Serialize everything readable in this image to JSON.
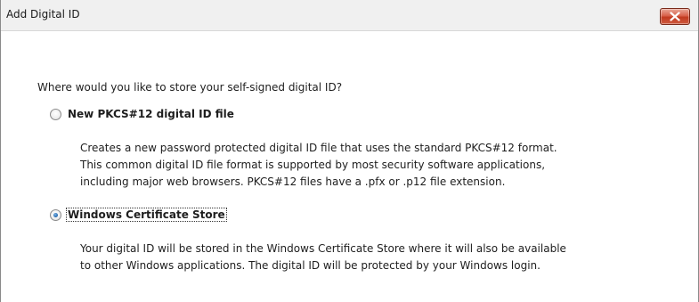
{
  "window": {
    "title": "Add Digital ID",
    "close_icon": "close-icon"
  },
  "content": {
    "question": "Where would you like to store your self-signed digital ID?",
    "options": [
      {
        "label": "New PKCS#12 digital ID file",
        "selected": false,
        "description": [
          "Creates a new password protected digital ID file that uses the standard PKCS#12 format.",
          "This common digital ID file format is supported by most security software applications,",
          "including major web browsers. PKCS#12 files have a .pfx or .p12 file extension."
        ]
      },
      {
        "label": "Windows Certificate Store",
        "selected": true,
        "description": [
          "Your digital ID will be stored in the Windows Certificate Store where it will also be available",
          "to other Windows applications. The digital ID will be protected by your Windows login."
        ]
      }
    ]
  }
}
